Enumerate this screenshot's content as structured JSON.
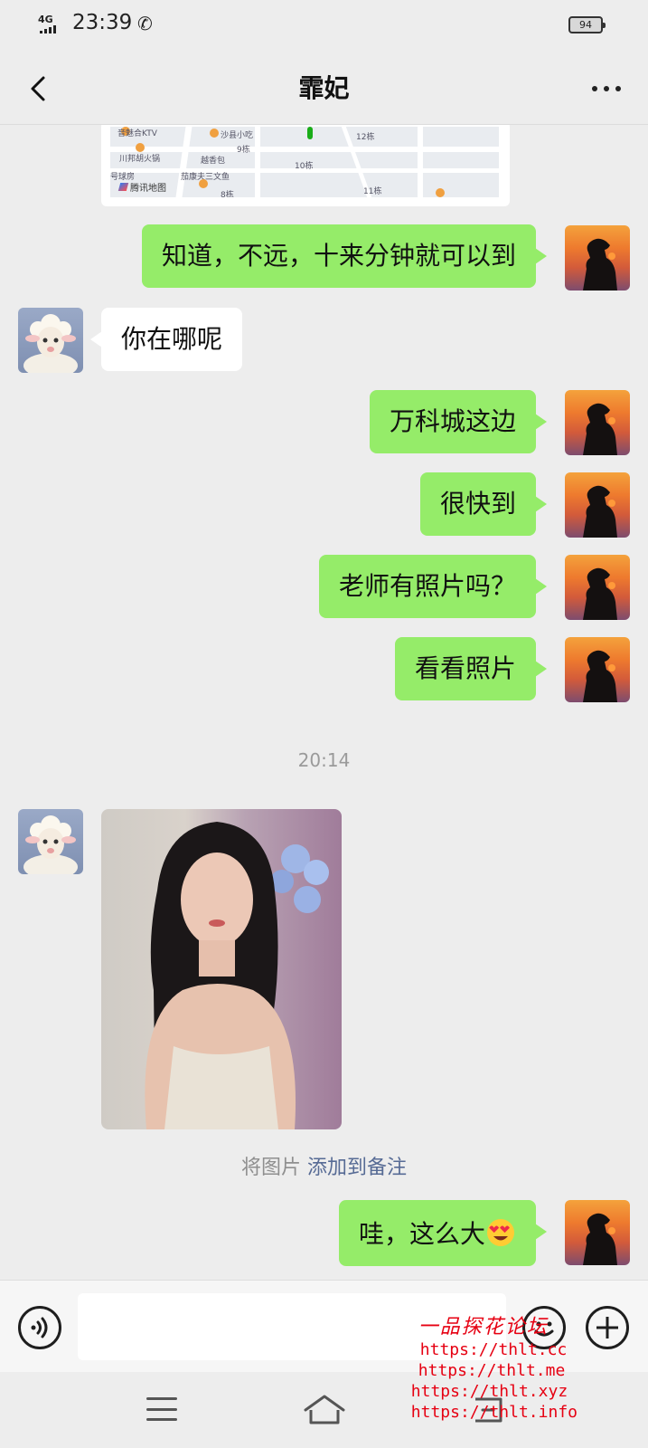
{
  "status_bar": {
    "network": "4G",
    "time": "23:39",
    "battery": "94"
  },
  "header": {
    "title": "霏妃"
  },
  "map_card": {
    "labels": [
      "音魅合KTV",
      "沙县小吃",
      "川邦胡火锅",
      "越香包",
      "号球房",
      "茄康夫三文鱼",
      "12栋",
      "9栋",
      "10栋",
      "8栋",
      "11栋",
      "腾讯地图"
    ]
  },
  "messages": [
    {
      "side": "right",
      "text": "知道，不远，十来分钟就可以到"
    },
    {
      "side": "left",
      "text": "你在哪呢"
    },
    {
      "side": "right",
      "text": "万科城这边"
    },
    {
      "side": "right",
      "text": "很快到"
    },
    {
      "side": "right",
      "text": "老师有照片吗？"
    },
    {
      "side": "right",
      "text": "看看照片"
    },
    {
      "side": "right",
      "text": "哇，这么大"
    }
  ],
  "timestamp": "20:14",
  "image_note": {
    "prefix": "将图片",
    "link": "添加到备注"
  },
  "watermark": {
    "title": "一品探花论坛",
    "urls": [
      "https://thlt.cc",
      "https://thlt.me",
      "https://thlt.xyz",
      "https://thlt.info"
    ]
  },
  "colors": {
    "bubble_sent": "#95ec69",
    "bubble_received": "#ffffff",
    "background": "#ededed",
    "link": "#576b95",
    "watermark": "#e60012"
  }
}
